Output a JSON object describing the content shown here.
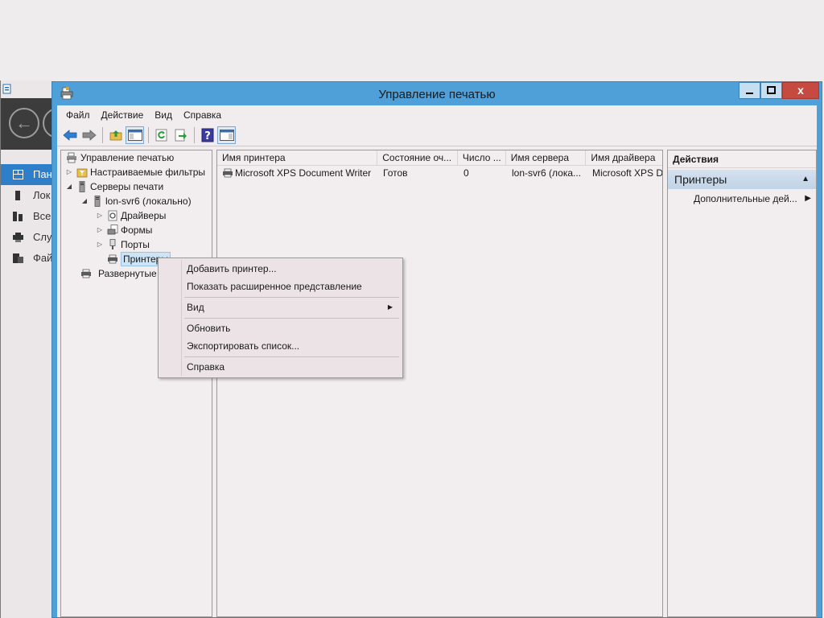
{
  "background_window": {
    "nav_items": [
      {
        "label": "Пан",
        "icon": "dashboard-icon",
        "active": true
      },
      {
        "label": "Лок",
        "icon": "local-server-icon"
      },
      {
        "label": "Все",
        "icon": "all-servers-icon"
      },
      {
        "label": "Слу",
        "icon": "services-icon"
      },
      {
        "label": "Фай",
        "icon": "file-services-icon"
      }
    ]
  },
  "window": {
    "title": "Управление печатью",
    "close_glyph": "x"
  },
  "menu": [
    "Файл",
    "Действие",
    "Вид",
    "Справка"
  ],
  "toolbar": [
    "back-icon",
    "forward-icon",
    "up-folder-icon",
    "show-hide-tree-icon",
    "refresh-icon",
    "export-icon",
    "help-icon",
    "action-pane-icon"
  ],
  "tree": {
    "root": "Управление печатью",
    "custom_filters": "Настраиваемые фильтры",
    "print_servers": "Серверы печати",
    "server": "lon-svr6 (локально)",
    "drivers": "Драйверы",
    "forms": "Формы",
    "ports": "Порты",
    "printers": "Принтеры",
    "deployed": "Развернутые п"
  },
  "list": {
    "columns": [
      "Имя принтера",
      "Состояние оч...",
      "Число ...",
      "Имя сервера",
      "Имя драйвера"
    ],
    "rows": [
      [
        "Microsoft XPS Document Writer",
        "Готов",
        "0",
        "lon-svr6 (лока...",
        "Microsoft XPS Do"
      ]
    ]
  },
  "actions": {
    "title": "Действия",
    "group": "Принтеры",
    "more": "Дополнительные дей..."
  },
  "context_menu": {
    "add_printer": "Добавить принтер...",
    "extended_view": "Показать расширенное представление",
    "view": "Вид",
    "refresh": "Обновить",
    "export": "Экспортировать список...",
    "help": "Справка"
  }
}
